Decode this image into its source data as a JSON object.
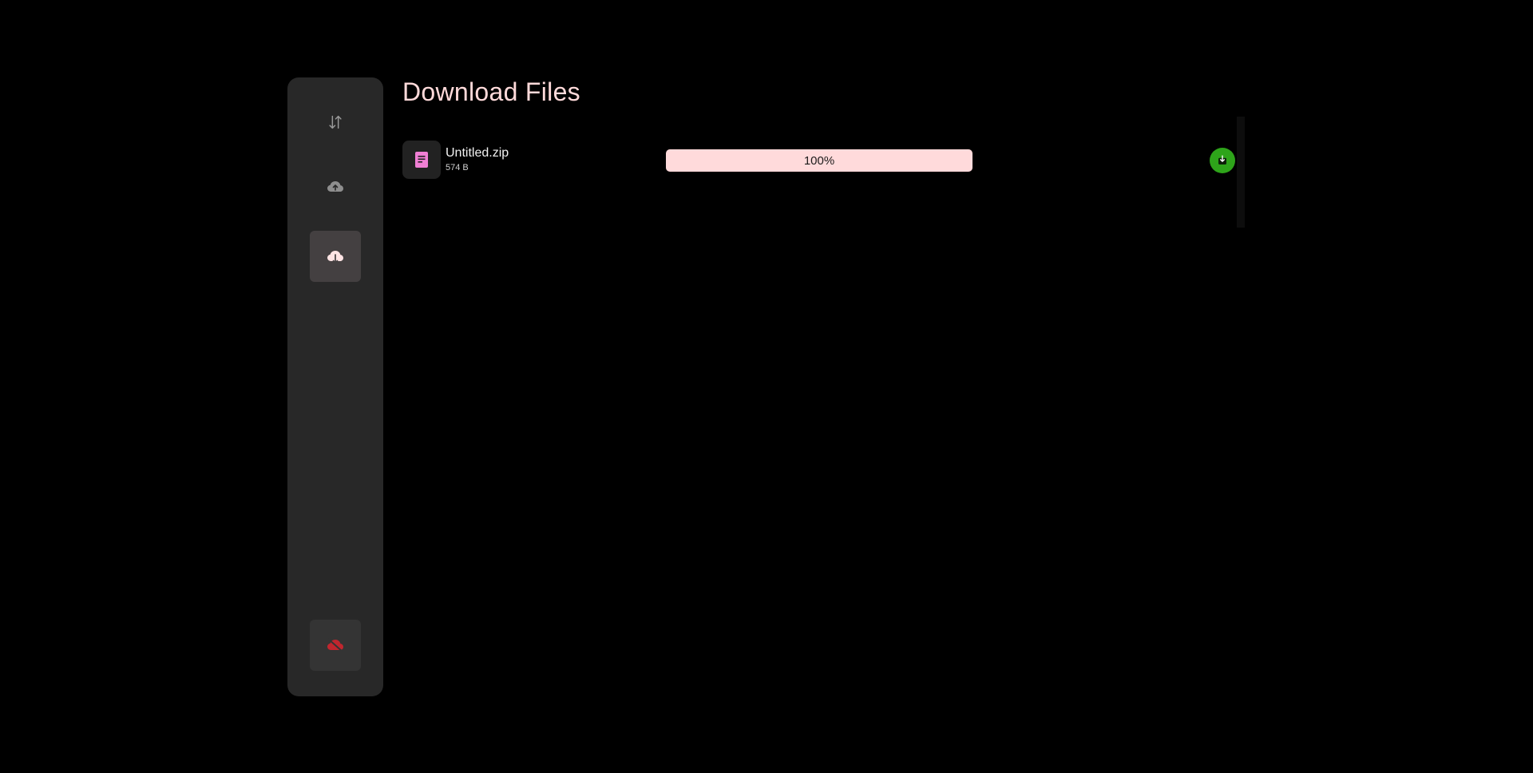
{
  "page": {
    "title": "Download Files"
  },
  "sidebar": {
    "items": [
      {
        "name": "transfer",
        "icon": "swap-vertical-icon",
        "active": false
      },
      {
        "name": "upload",
        "icon": "cloud-upload-icon",
        "active": false
      },
      {
        "name": "download",
        "icon": "cloud-download-icon",
        "active": true
      }
    ],
    "footer": {
      "name": "disconnect",
      "icon": "cloud-off-icon",
      "color": "#c0262e"
    }
  },
  "files": [
    {
      "name": "Untitled.zip",
      "size": "574 B",
      "icon": "document-icon",
      "progress_percent": 100,
      "progress_label": "100%",
      "status": "complete",
      "status_icon": "download-done-icon"
    }
  ],
  "colors": {
    "background": "#000000",
    "sidebar": "#282828",
    "accent": "#ffdada",
    "file_icon": "#f07fd4",
    "progress_fill": "#ffdadb",
    "success": "#2ea41a"
  }
}
